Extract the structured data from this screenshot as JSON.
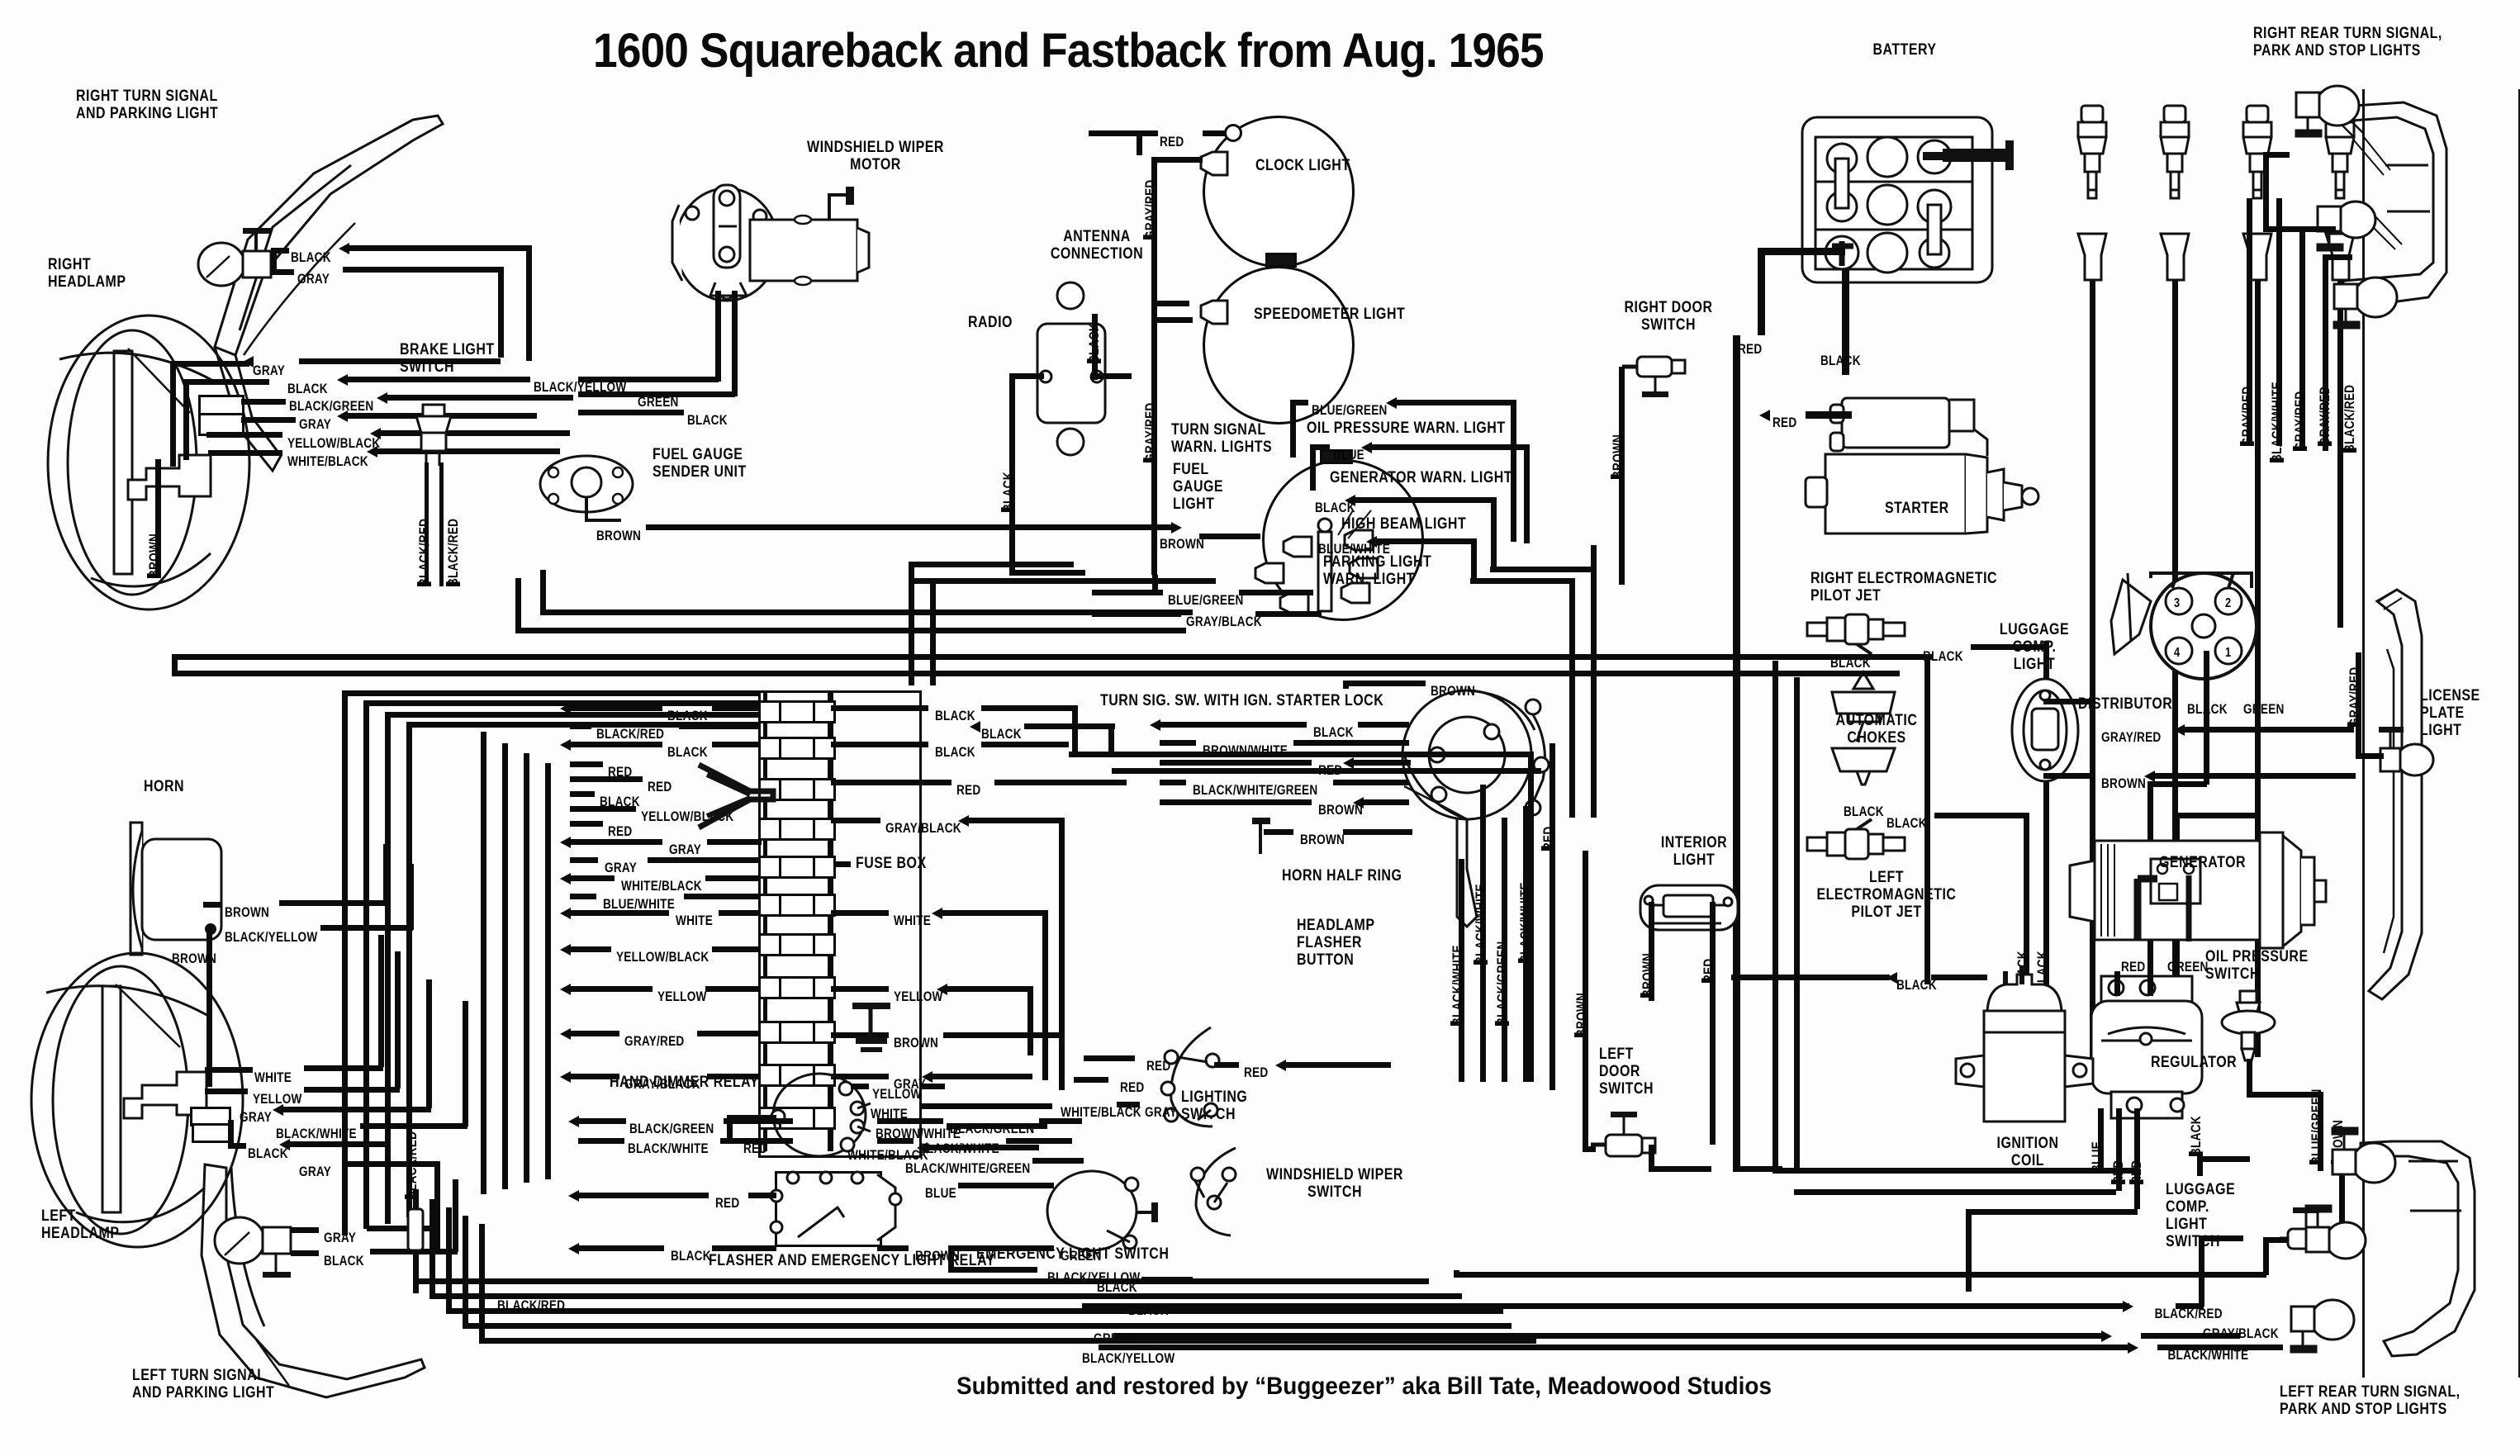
{
  "title": "1600 Squareback and Fastback from Aug. 1965",
  "footer": "Submitted and restored by “Buggeezer” aka Bill Tate, Meadowood Studios",
  "components": {
    "right_turn_signal": "RIGHT TURN SIGNAL\nAND PARKING LIGHT",
    "right_headlamp": "RIGHT\nHEADLAMP",
    "brake_light_switch": "BRAKE LIGHT\nSWITCH",
    "windshield_wiper_motor": "WINDSHIELD WIPER\nMOTOR",
    "fuel_gauge_sender": "FUEL GAUGE\nSENDER UNIT",
    "antenna_connection": "ANTENNA\nCONNECTION",
    "radio": "RADIO",
    "clock_light": "CLOCK LIGHT",
    "speedometer_light": "SPEEDOMETER LIGHT",
    "turn_signal_warn_lights": "TURN SIGNAL\nWARN. LIGHTS",
    "fuel_gauge_light": "FUEL\nGAUGE\nLIGHT",
    "oil_pressure_warn_light": "OIL PRESSURE WARN. LIGHT",
    "generator_warn_light": "GENERATOR WARN. LIGHT",
    "high_beam_light": "HIGH BEAM LIGHT",
    "parking_light_warn_light": "PARKING LIGHT\nWARN. LIGHT",
    "right_door_switch": "RIGHT DOOR\nSWITCH",
    "battery": "BATTERY",
    "starter": "STARTER",
    "right_pilot_jet": "RIGHT ELECTROMAGNETIC\nPILOT JET",
    "automatic_chokes": "AUTOMATIC\nCHOKES",
    "left_pilot_jet": "LEFT\nELECTROMAGNETIC\nPILOT JET",
    "luggage_comp_light": "LUGGAGE\nCOMP.\nLIGHT",
    "distributor": "DISTRIBUTOR",
    "generator": "GENERATOR",
    "oil_pressure_switch": "OIL PRESSURE\nSWITCH",
    "regulator": "REGULATOR",
    "ignition_coil": "IGNITION\nCOIL",
    "interior_light": "INTERIOR\nLIGHT",
    "left_door_switch": "LEFT\nDOOR\nSWITCH",
    "luggage_comp_light_switch": "LUGGAGE\nCOMP.\nLIGHT\nSWITCH",
    "right_rear_lights": "RIGHT REAR TURN SIGNAL,\nPARK AND STOP LIGHTS",
    "left_rear_lights": "LEFT REAR TURN SIGNAL,\nPARK AND STOP LIGHTS",
    "license_plate_light": "LICENSE\nPLATE\nLIGHT",
    "horn": "HORN",
    "left_headlamp": "LEFT\nHEADLAMP",
    "left_turn_signal": "LEFT TURN SIGNAL\nAND PARKING LIGHT",
    "fuse_box": "FUSE BOX",
    "hand_dimmer_relay": "HAND DIMMER RELAY",
    "turn_sig_switch": "TURN SIG. SW. WITH IGN. STARTER LOCK",
    "horn_half_ring": "HORN HALF RING",
    "headlamp_flasher_button": "HEADLAMP\nFLASHER\nBUTTON",
    "lighting_switch": "LIGHTING\nSWITCH",
    "flasher_relay": "FLASHER AND EMERGENCY LIGHT RELAY",
    "emergency_light_switch": "EMERGENCY LIGHT SWITCH",
    "windshield_wiper_switch": "WINDSHIELD WIPER\nSWITCH"
  },
  "distributor_terminals": [
    "3",
    "2",
    "4",
    "1"
  ],
  "wire_labels": {
    "black": "BLACK",
    "gray": "GRAY",
    "red": "RED",
    "brown": "BROWN",
    "white": "WHITE",
    "yellow": "YELLOW",
    "green": "GREEN",
    "blue": "BLUE",
    "black_green": "BLACK/GREEN",
    "black_red": "BLACK/RED",
    "black_white": "BLACK/WHITE",
    "black_yellow": "BLACK/YELLOW",
    "yellow_black": "YELLOW/BLACK",
    "white_black": "WHITE/BLACK",
    "gray_red": "GRAY/RED",
    "gray_black": "GRAY/BLACK",
    "blue_white": "BLUE/WHITE",
    "blue_green": "BLUE/GREEN",
    "brown_white": "BROWN/WHITE",
    "black_white_green": "BLACK/WHITE/GREEN",
    "black_yellow2": "BLACK / YELLOW"
  },
  "chart_data": {
    "type": "table",
    "title": "1600 Squareback and Fastback from Aug. 1965",
    "description": "Automotive electrical wiring schematic",
    "wire_color_codes": [
      "BLACK",
      "GRAY",
      "RED",
      "BROWN",
      "WHITE",
      "YELLOW",
      "GREEN",
      "BLUE",
      "BLACK/GREEN",
      "BLACK/RED",
      "BLACK/WHITE",
      "BLACK/YELLOW",
      "YELLOW/BLACK",
      "WHITE/BLACK",
      "GRAY/RED",
      "GRAY/BLACK",
      "BLUE/WHITE",
      "BLUE/GREEN",
      "BROWN/WHITE",
      "BLACK/WHITE/GREEN"
    ],
    "fuse_box_inputs": [
      "BLACK",
      "BLACK/RED",
      "BLACK",
      "RED",
      "RED",
      "BLACK",
      "YELLOW/BLACK",
      "RED",
      "GRAY",
      "GRAY",
      "WHITE/BLACK",
      "BLUE/WHITE",
      "WHITE",
      "YELLOW/BLACK",
      "YELLOW",
      "GRAY/RED",
      "GRAY/BLACK"
    ],
    "fuse_box_outputs": [
      "BLACK",
      "BLACK",
      "BLACK",
      "RED",
      "GRAY/BLACK",
      "WHITE",
      "YELLOW",
      "BROWN",
      "GRAY"
    ],
    "dashboard_indicators": [
      "CLOCK LIGHT",
      "SPEEDOMETER LIGHT",
      "TURN SIGNAL WARN. LIGHTS",
      "FUEL GAUGE LIGHT",
      "OIL PRESSURE WARN. LIGHT",
      "GENERATOR WARN. LIGHT",
      "HIGH BEAM LIGHT",
      "PARKING LIGHT WARN. LIGHT"
    ]
  }
}
